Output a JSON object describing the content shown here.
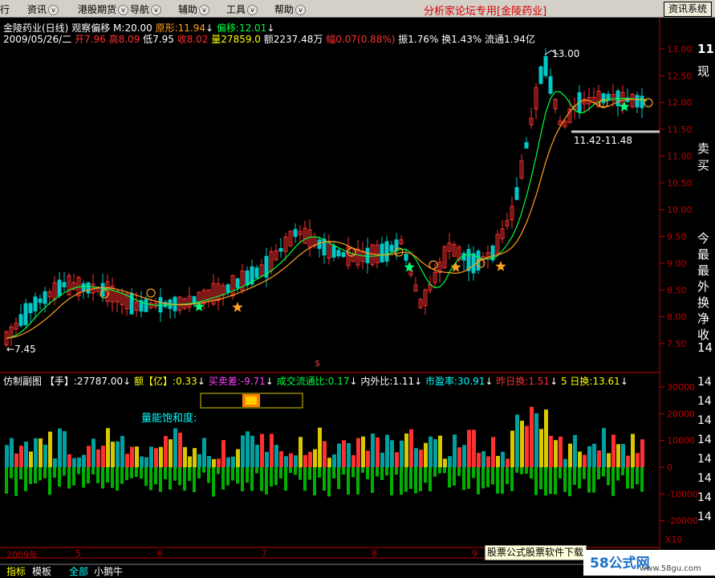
{
  "menu": {
    "left_glyph": "行",
    "items": [
      {
        "label": "资讯"
      },
      {
        "label": "港股期货"
      },
      {
        "label": "导航"
      },
      {
        "label": "辅助"
      },
      {
        "label": "工具"
      },
      {
        "label": "帮助"
      }
    ],
    "arrow": "v",
    "brand": "分析家论坛专用[金陵药业]",
    "news_button": "资讯系统"
  },
  "main_chart": {
    "title": "金陵药业(日线)",
    "indicator_name": "观察偏移",
    "m_param": "M:20.00",
    "yuanxing_label": "原形:11.94",
    "pianyi_label": "偏移:12.01",
    "info_date": "2009/05/26/二",
    "open": "开7.96",
    "high": "高8.09",
    "low": "低7.95",
    "close": "收8.02",
    "volume": "量27859.0",
    "amount": "额2237.48万",
    "range": "幅0.07(0.88%)",
    "amplitude": "振1.76%",
    "turnover": "换1.43%",
    "float": "流通1.94亿",
    "peak_label": "13.00",
    "low_label": "7.45",
    "range_label": "11.42-11.48",
    "y_ticks": [
      "13.00",
      "12.50",
      "12.00",
      "11.50",
      "11.00",
      "10.50",
      "10.00",
      "9.50",
      "9.00",
      "8.50",
      "8.00",
      "7.50"
    ],
    "right_side_chars": [
      "11",
      "现",
      "卖",
      "买",
      "今",
      "最",
      "最",
      "外",
      "换",
      "净",
      "收",
      "14"
    ],
    "marker": "$"
  },
  "sub_chart": {
    "title": "仿制副图",
    "hand_label": "【手】:27787.00",
    "amount_label": "额【亿】:0.33",
    "buysell_label": "买卖差:-9.71",
    "flow_ratio_label": "成交流通比:0.17",
    "inout_label": "内外比:1.11",
    "pe_label": "市盈率:30.91",
    "yesterday_label": "昨日换:1.51",
    "five_day_label": "5 日换:13.61",
    "saturation_label": "量能饱和度:",
    "y_ticks": [
      "30000",
      "20000",
      "10000",
      "0",
      "-10000",
      "-20000"
    ],
    "x10": "X10",
    "right_side_chars": [
      "14",
      "14",
      "14",
      "14",
      "14",
      "14",
      "14",
      "14"
    ]
  },
  "x_axis": {
    "year_label": "2009年",
    "month_labels": [
      "5",
      "6",
      "7",
      "8",
      "9"
    ]
  },
  "bottom_tabs": [
    "指标",
    "模板",
    "全部",
    "小鹅牛"
  ],
  "ad_text": "股票公式股票软件下载",
  "logo": {
    "text": "58公式网",
    "url": "www.58gu.com"
  },
  "colors": {
    "up": "#ff3030",
    "down": "#00c8c8",
    "ma_green": "#00ff40",
    "ma_orange": "#ffa020",
    "yellow_bar": "#d8c800",
    "teal_bar": "#00a0a0",
    "green_bar": "#00b000",
    "axis_red": "#c00000"
  }
}
